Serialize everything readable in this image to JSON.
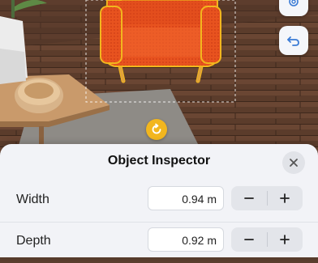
{
  "panel": {
    "title": "Object Inspector"
  },
  "properties": [
    {
      "label": "Width",
      "value": "0.94 m"
    },
    {
      "label": "Depth",
      "value": "0.92 m"
    }
  ],
  "icons": {
    "settings": "gear-icon",
    "undo": "undo-arrow-icon",
    "rotate": "rotate-icon",
    "close": "close-icon",
    "minus": "minus-icon",
    "plus": "plus-icon"
  },
  "colors": {
    "accent": "#3a7bd5",
    "selection": "#f2b61e",
    "chair": "#e8531f"
  }
}
